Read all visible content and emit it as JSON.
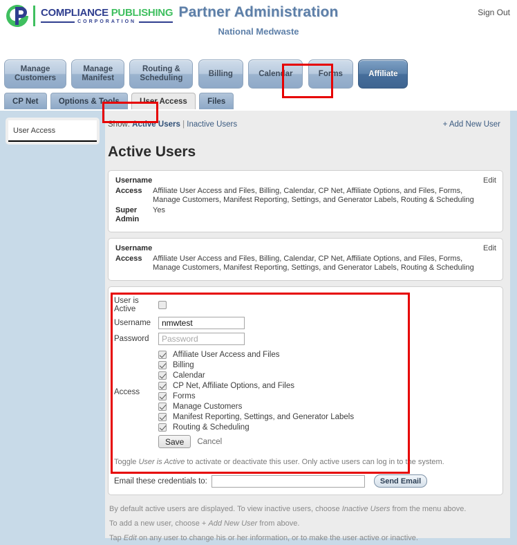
{
  "header": {
    "logo": {
      "name_part1": "COMPLIANCE ",
      "name_part2": "PUBLISHING",
      "corp": "CORPORATION",
      "mark_icon": "compliance-c-logo-icon"
    },
    "title": "Partner Administration",
    "subtitle": "National Medwaste",
    "sign_out": "Sign Out"
  },
  "main_tabs": [
    {
      "id": "manage-customers",
      "line1": "Manage",
      "line2": "Customers",
      "active": false
    },
    {
      "id": "manage-manifest",
      "line1": "Manage",
      "line2": "Manifest",
      "active": false
    },
    {
      "id": "routing-scheduling",
      "line1": "Routing &",
      "line2": "Scheduling",
      "active": false
    },
    {
      "id": "billing",
      "line1": "Billing",
      "line2": "",
      "active": false
    },
    {
      "id": "calendar",
      "line1": "Calendar",
      "line2": "",
      "active": false
    },
    {
      "id": "forms",
      "line1": "Forms",
      "line2": "",
      "active": false
    },
    {
      "id": "affiliate",
      "line1": "Affiliate",
      "line2": "",
      "active": true
    }
  ],
  "sub_tabs": [
    {
      "id": "cp-net",
      "label": "CP Net",
      "active": false
    },
    {
      "id": "options-tools",
      "label": "Options & Tools",
      "active": false
    },
    {
      "id": "user-access",
      "label": "User Access",
      "active": true
    },
    {
      "id": "files",
      "label": "Files",
      "active": false
    }
  ],
  "sidebar": {
    "items": [
      {
        "id": "user-access",
        "label": "User Access"
      }
    ]
  },
  "content": {
    "show_label": "Show:",
    "show_active": "Active Users",
    "show_separator": "|",
    "show_inactive": "Inactive Users",
    "add_new_user": "+ Add New User",
    "page_title": "Active Users",
    "edit_label": "Edit"
  },
  "users": [
    {
      "username_label": "Username",
      "username_value": "",
      "access_label": "Access",
      "access_value": "Affiliate User Access and Files, Billing, Calendar, CP Net, Affiliate Options, and Files, Forms, Manage Customers, Manifest Reporting, Settings, and Generator Labels, Routing & Scheduling",
      "super_admin_label": "Super Admin",
      "super_admin_value": "Yes"
    },
    {
      "username_label": "Username",
      "username_value": "",
      "access_label": "Access",
      "access_value": "Affiliate User Access and Files, Billing, Calendar, CP Net, Affiliate Options, and Files, Forms, Manage Customers, Manifest Reporting, Settings, and Generator Labels, Routing & Scheduling"
    }
  ],
  "edit_form": {
    "user_is_active_label": "User is Active",
    "user_is_active_checked": false,
    "username_label": "Username",
    "username_value": "nmwtest",
    "username_placeholder": "",
    "password_label": "Password",
    "password_value": "",
    "password_placeholder": "Password",
    "access_label": "Access",
    "access_options": [
      {
        "id": "affiliate-user-access-and-files",
        "label": "Affiliate User Access and Files",
        "checked": true
      },
      {
        "id": "billing",
        "label": "Billing",
        "checked": true
      },
      {
        "id": "calendar",
        "label": "Calendar",
        "checked": true
      },
      {
        "id": "cp-net-affiliate-options-and-files",
        "label": "CP Net, Affiliate Options, and Files",
        "checked": true
      },
      {
        "id": "forms",
        "label": "Forms",
        "checked": true
      },
      {
        "id": "manage-customers",
        "label": "Manage Customers",
        "checked": true
      },
      {
        "id": "manifest-reporting-settings-and-generator-labels",
        "label": "Manifest Reporting, Settings, and Generator Labels",
        "checked": true
      },
      {
        "id": "routing-scheduling",
        "label": "Routing & Scheduling",
        "checked": true
      }
    ],
    "save_label": "Save",
    "cancel_label": "Cancel",
    "toggle_note_pre": "Toggle ",
    "toggle_note_em": "User is Active",
    "toggle_note_post": " to activate or deactivate this user. Only active users can log in to the system.",
    "email_label": "Email these credentials to:",
    "email_value": "",
    "email_placeholder": "",
    "send_email_label": "Send Email"
  },
  "footer_notes": {
    "note1_pre": "By default active users are displayed. To view inactive users, choose ",
    "note1_em": "Inactive Users",
    "note1_post": " from the menu above.",
    "note2_pre": "To add a new user, choose + ",
    "note2_em": "Add New User",
    "note2_post": " from above.",
    "note3_pre": "Tap ",
    "note3_em": "Edit",
    "note3_post": " on any user to change his or her information, or to make the user active or inactive."
  },
  "colors": {
    "highlight": "#e60000",
    "accent_blue": "#5d7fa8",
    "logo_green": "#3fbf5f",
    "logo_navy": "#2f3e8f",
    "panel_bg": "#ececec",
    "page_bg": "#c8dae8"
  }
}
